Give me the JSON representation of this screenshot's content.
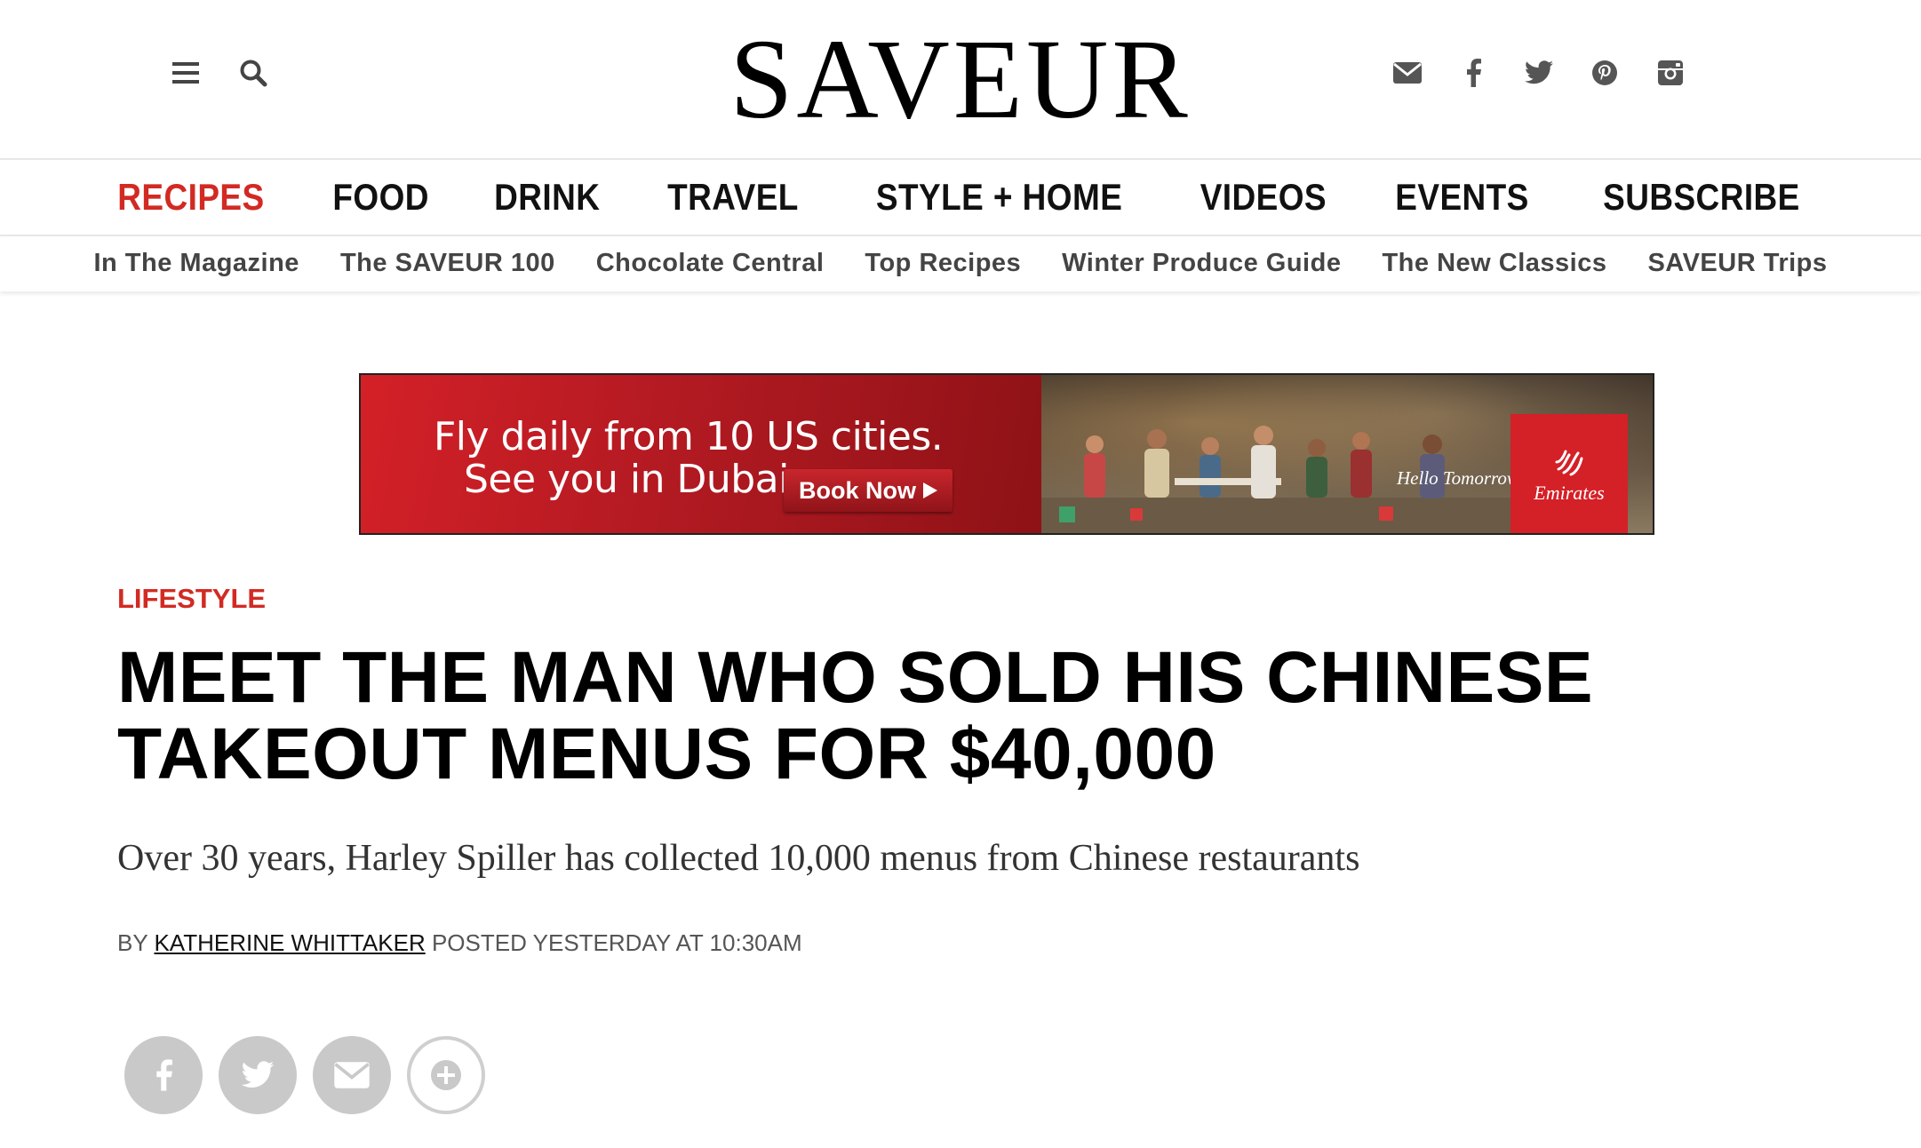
{
  "header": {
    "logo": "SAVEUR",
    "left_icons": [
      "menu-icon",
      "search-icon"
    ],
    "social_icons": [
      "email-icon",
      "facebook-icon",
      "twitter-icon",
      "pinterest-icon",
      "instagram-icon"
    ]
  },
  "main_nav": [
    {
      "label": "RECIPES",
      "active": true
    },
    {
      "label": "FOOD"
    },
    {
      "label": "DRINK"
    },
    {
      "label": "TRAVEL"
    },
    {
      "label": "STYLE + HOME"
    },
    {
      "label": "VIDEOS"
    },
    {
      "label": "EVENTS"
    },
    {
      "label": "SUBSCRIBE"
    }
  ],
  "sub_nav": [
    "In The Magazine",
    "The SAVEUR 100",
    "Chocolate Central",
    "Top Recipes",
    "Winter Produce Guide",
    "The New Classics",
    "SAVEUR Trips"
  ],
  "ad": {
    "line1": "Fly daily from 10 US cities.",
    "line2": "See you in Dubai",
    "button": "Book Now",
    "tagline": "Hello Tomorrow",
    "brand": "Emirates",
    "brand_color": "#d42027"
  },
  "article": {
    "category": "LIFESTYLE",
    "headline": "MEET THE MAN WHO SOLD HIS CHINESE TAKEOUT MENUS FOR $40,000",
    "subhead": "Over 30 years, Harley Spiller has collected 10,000 menus from Chinese restaurants",
    "by_prefix": "BY",
    "author": "KATHERINE WHITTAKER",
    "posted": "POSTED YESTERDAY AT 10:30AM"
  },
  "share_icons": [
    "facebook-share-icon",
    "twitter-share-icon",
    "email-share-icon",
    "more-share-icon"
  ],
  "colors": {
    "accent": "#d22a23",
    "share_gray": "#c9c9c9"
  }
}
